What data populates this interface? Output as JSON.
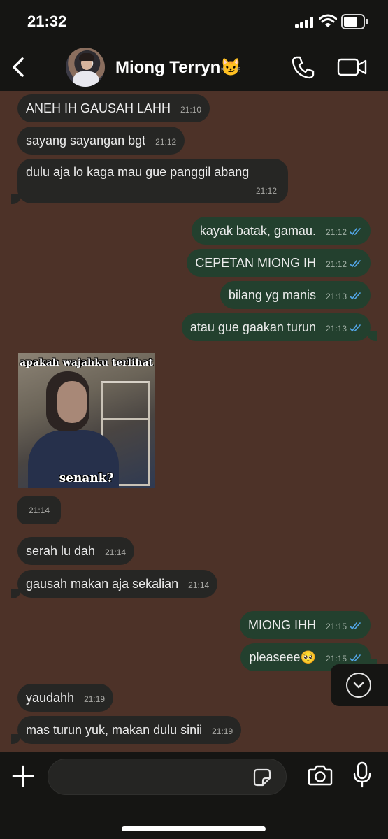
{
  "status_bar": {
    "time": "21:32"
  },
  "header": {
    "contact_name": "Miong Terryn😼"
  },
  "messages": [
    {
      "dir": "in",
      "text": "ANEH IH GAUSAH LAHH",
      "time": "21:10"
    },
    {
      "dir": "in",
      "text": "sayang sayangan bgt",
      "time": "21:12"
    },
    {
      "dir": "in",
      "text": "dulu aja lo kaga mau gue panggil abang",
      "time": "21:12"
    },
    {
      "dir": "out",
      "text": "kayak batak, gamau.",
      "time": "21:12",
      "read": true
    },
    {
      "dir": "out",
      "text": "CEPETAN MIONG IH",
      "time": "21:12",
      "read": true
    },
    {
      "dir": "out",
      "text": "bilang yg manis",
      "time": "21:13",
      "read": true
    },
    {
      "dir": "out",
      "text": "atau gue gaakan turun",
      "time": "21:13",
      "read": true
    },
    {
      "dir": "in",
      "text": "serah lu dah",
      "time": "21:14"
    },
    {
      "dir": "in",
      "text": "gausah makan aja sekalian",
      "time": "21:14"
    },
    {
      "dir": "out",
      "text": "MIONG IHH",
      "time": "21:15",
      "read": true
    },
    {
      "dir": "out",
      "text": "pleaseee🥺",
      "time": "21:15",
      "read": true
    },
    {
      "dir": "in",
      "text": "yaudahh",
      "time": "21:19"
    },
    {
      "dir": "in",
      "text": "mas turun yuk, makan dulu sinii",
      "time": "21:19"
    }
  ],
  "image_message": {
    "caption_top": "apakah wajahku terlihat",
    "caption_bottom": "senank?",
    "time": "21:14"
  },
  "composer": {
    "placeholder": ""
  },
  "colors": {
    "chat_background": "#4d3228",
    "incoming_bubble": "#262624",
    "outgoing_bubble": "#23402e",
    "read_tick": "#53a6e8",
    "bars": "#151513"
  },
  "icons": {
    "back": "chevron-left-icon",
    "call": "phone-icon",
    "video": "video-camera-icon",
    "scroll": "chevron-down-icon",
    "add": "plus-icon",
    "sticker": "sticker-icon",
    "camera": "camera-icon",
    "mic": "microphone-icon"
  }
}
